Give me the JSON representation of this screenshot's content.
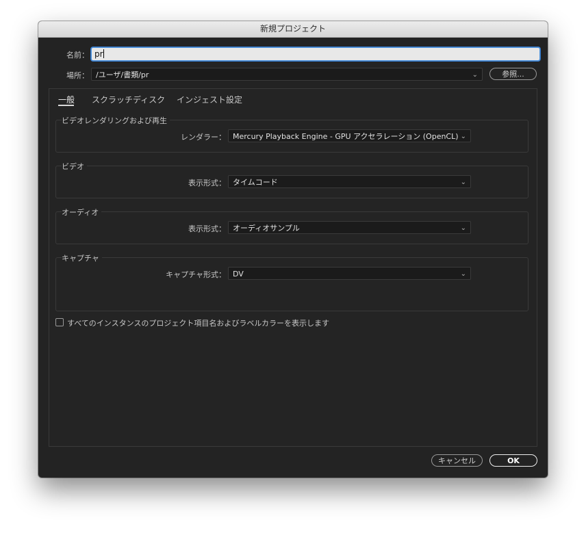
{
  "window": {
    "title": "新規プロジェクト"
  },
  "name": {
    "label": "名前：",
    "value": "pr"
  },
  "location": {
    "label": "場所：",
    "path": "/ユーザ/書類/pr",
    "browse_label": "参照..."
  },
  "tabs": [
    {
      "label": "一般",
      "active": true
    },
    {
      "label": "スクラッチディスク",
      "active": false
    },
    {
      "label": "インジェスト設定",
      "active": false
    }
  ],
  "video_rendering": {
    "title": "ビデオレンダリングおよび再生",
    "renderer_label": "レンダラー：",
    "renderer_value": "Mercury Playback Engine - GPU アクセラレーション (OpenCL)"
  },
  "video": {
    "title": "ビデオ",
    "format_label": "表示形式：",
    "format_value": "タイムコード"
  },
  "audio": {
    "title": "オーディオ",
    "format_label": "表示形式：",
    "format_value": "オーディオサンプル"
  },
  "capture": {
    "title": "キャプチャ",
    "format_label": "キャプチャ形式：",
    "format_value": "DV"
  },
  "option": {
    "label": "すべてのインスタンスのプロジェクト項目名およびラベルカラーを表示します",
    "checked": false
  },
  "footer": {
    "cancel_label": "キャンセル",
    "ok_label": "OK"
  },
  "icons": {
    "dropdown": "chevron-down-icon",
    "checkbox": "checkbox-unchecked"
  }
}
